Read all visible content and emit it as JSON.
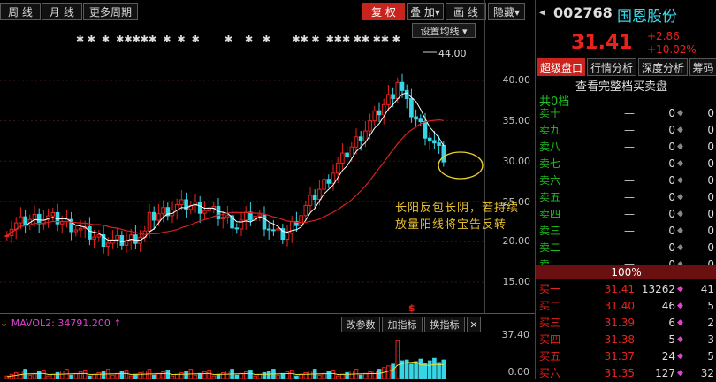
{
  "toolbar": {
    "left": [
      "周 线",
      "月 线",
      "更多周期"
    ],
    "right": [
      "复 权",
      "叠 加",
      "画 线",
      "隐藏"
    ],
    "set_ma_label": "设置均线",
    "right_arrow": "▸"
  },
  "chart": {
    "price_ticks": [
      "40.00",
      "35.00",
      "30.00",
      "25.00",
      "20.00",
      "15.00"
    ],
    "max_label": "44.00",
    "dollar_marker": "$",
    "annotation_line1": "长阳反包长阴，若持续",
    "annotation_line2": "放量阳线将宝告反转",
    "star_marks": "✱ ✱  ✱  ✱✱✱✱✱  ✱  ✱  ✱        ✱    ✱   ✱       ✱✱ ✱  ✱✱✱ ✱✱ ✱✱ ✱"
  },
  "chart_data": {
    "type": "candlestick",
    "price_axis_ticks": [
      15,
      20,
      25,
      30,
      35,
      40
    ],
    "max_price": 44.0,
    "last_close": 31.41,
    "volume_axis_ticks": [
      0.0,
      37.4
    ],
    "volume_label": "MAVOL2: 34791.200"
  },
  "volume_panel": {
    "label": "MAVOL2: 34791.200",
    "buttons": [
      "改参数",
      "加指标",
      "换指标"
    ],
    "ticks": [
      "37.40",
      "0.00"
    ]
  },
  "stock": {
    "code": "002768",
    "name": "国恩股份",
    "price": "31.41",
    "change": "+2.86",
    "change_pct": "+10.02%"
  },
  "tabs": [
    "超级盘口",
    "行情分析",
    "深度分析",
    "筹码"
  ],
  "orderbook": {
    "header": "查看完整档买卖盘",
    "total_label": "共0档",
    "sell_rows": [
      {
        "label": "卖十",
        "price": "—",
        "vol": "0",
        "extra": "0"
      },
      {
        "label": "卖九",
        "price": "—",
        "vol": "0",
        "extra": "0"
      },
      {
        "label": "卖八",
        "price": "—",
        "vol": "0",
        "extra": "0"
      },
      {
        "label": "卖七",
        "price": "—",
        "vol": "0",
        "extra": "0"
      },
      {
        "label": "卖六",
        "price": "—",
        "vol": "0",
        "extra": "0"
      },
      {
        "label": "卖五",
        "price": "—",
        "vol": "0",
        "extra": "0"
      },
      {
        "label": "卖四",
        "price": "—",
        "vol": "0",
        "extra": "0"
      },
      {
        "label": "卖三",
        "price": "—",
        "vol": "0",
        "extra": "0"
      },
      {
        "label": "卖二",
        "price": "—",
        "vol": "0",
        "extra": "0"
      },
      {
        "label": "卖一",
        "price": "—",
        "vol": "0",
        "extra": "0"
      }
    ],
    "ratio": "100%",
    "buy_rows": [
      {
        "label": "买一",
        "price": "31.41",
        "vol": "13262",
        "extra": "41"
      },
      {
        "label": "买二",
        "price": "31.40",
        "vol": "46",
        "extra": "5"
      },
      {
        "label": "买三",
        "price": "31.39",
        "vol": "6",
        "extra": "2"
      },
      {
        "label": "买四",
        "price": "31.38",
        "vol": "5",
        "extra": "3"
      },
      {
        "label": "买五",
        "price": "31.37",
        "vol": "24",
        "extra": "5"
      },
      {
        "label": "买六",
        "price": "31.35",
        "vol": "127",
        "extra": "32"
      }
    ]
  },
  "colors": {
    "red": "#e8231c",
    "cyan": "#37d6e6",
    "green": "#20c020",
    "accent": "#c8231c"
  }
}
